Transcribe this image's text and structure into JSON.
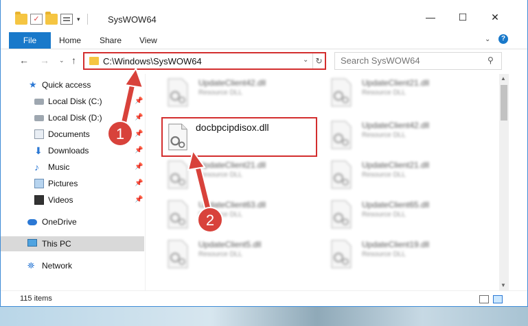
{
  "window": {
    "title": "SysWOW64",
    "qat_dropdown": "▾",
    "minimize": "—",
    "maximize": "☐",
    "close": "✕"
  },
  "ribbon": {
    "file": "File",
    "home": "Home",
    "share": "Share",
    "view": "View",
    "collapse": "⌄",
    "help": "?"
  },
  "nav": {
    "back": "←",
    "forward": "→",
    "recent": "⌄",
    "up": "↑",
    "address": "C:\\Windows\\SysWOW64",
    "address_dropdown": "⌄",
    "refresh": "↻",
    "search_placeholder": "Search SysWOW64",
    "search_icon_glyph": "⚲"
  },
  "sidebar": {
    "items": [
      {
        "label": "Quick access",
        "icon": "star-icon"
      },
      {
        "label": "Local Disk (C:)",
        "icon": "drive-icon",
        "pinned": true
      },
      {
        "label": "Local Disk (D:)",
        "icon": "drive-icon",
        "pinned": true
      },
      {
        "label": "Documents",
        "icon": "documents-icon",
        "pinned": true
      },
      {
        "label": "Downloads",
        "icon": "download-icon",
        "pinned": true
      },
      {
        "label": "Music",
        "icon": "music-icon",
        "pinned": true
      },
      {
        "label": "Pictures",
        "icon": "pictures-icon",
        "pinned": true
      },
      {
        "label": "Videos",
        "icon": "videos-icon",
        "pinned": true
      },
      {
        "label": "OneDrive",
        "icon": "cloud-icon"
      },
      {
        "label": "This PC",
        "icon": "computer-icon"
      },
      {
        "label": "Network",
        "icon": "network-icon"
      }
    ],
    "pin_glyph": "📌"
  },
  "files": {
    "highlighted": {
      "name": "docbpcipdisox.dll"
    },
    "left_column": [
      {
        "name": "UpdateClient42.dll",
        "type": "Resource DLL"
      },
      {
        "name": "UpdateClient21.dll",
        "type": "Resource DLL"
      },
      {
        "name": "UpdateClient63.dll",
        "type": "Resource DLL"
      },
      {
        "name": "UpdateClient5.dll",
        "type": "Resource DLL"
      }
    ],
    "right_column": [
      {
        "name": "UpdateClient21.dll",
        "type": "Resource DLL"
      },
      {
        "name": "UpdateClient42.dll",
        "type": "Resource DLL"
      },
      {
        "name": "UpdateClient21.dll",
        "type": "Resource DLL"
      },
      {
        "name": "UpdateClient65.dll",
        "type": "Resource DLL"
      },
      {
        "name": "UpdateClient19.dll",
        "type": "Resource DLL"
      }
    ]
  },
  "status": {
    "item_count": "115 items"
  },
  "annotations": {
    "badge1": "1",
    "badge2": "2"
  },
  "colors": {
    "accent": "#1979ca",
    "highlight_box": "#d32d2d",
    "badge_fill": "#d8423b"
  }
}
